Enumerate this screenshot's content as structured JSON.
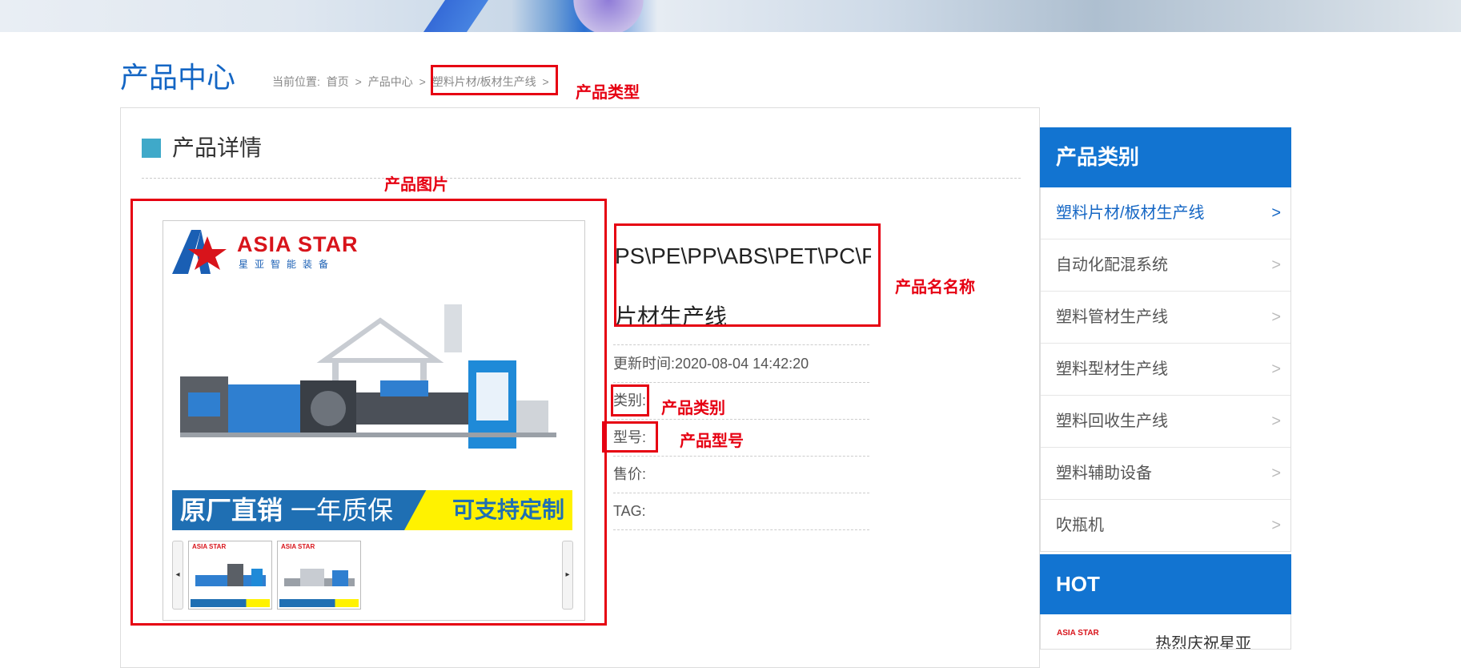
{
  "page": {
    "title": "产品中心",
    "breadcrumb": {
      "prefix": "当前位置:",
      "items": [
        "首页",
        "产品中心",
        "塑料片材/板材生产线"
      ],
      "sep": ">"
    }
  },
  "section": {
    "title": "产品详情"
  },
  "product": {
    "name_line1": "PS\\PE\\PP\\ABS\\PET\\PC\\P",
    "name_line2": "片材生产线",
    "updated": "更新时间:2020-08-04 14:42:20",
    "category_label": "类别:",
    "model_label": "型号:",
    "price_label": "售价:",
    "tag_label": "TAG:",
    "image": {
      "logo_text": "ASIA STAR",
      "logo_sub": "星亚智能装备",
      "promo_left": "原厂直销",
      "promo_left2": "一年质保",
      "promo_right": "可支持定制"
    },
    "thumbnails": [
      {
        "logo": "ASIA STAR"
      },
      {
        "logo": "ASIA STAR"
      }
    ]
  },
  "annotations": {
    "product_type": "产品类型",
    "product_image": "产品图片",
    "product_name": "产品名名称",
    "product_category": "产品类别",
    "product_model": "产品型号"
  },
  "sidebar": {
    "title": "产品类别",
    "items": [
      {
        "label": "塑料片材/板材生产线",
        "active": true
      },
      {
        "label": "自动化配混系统"
      },
      {
        "label": "塑料管材生产线"
      },
      {
        "label": "塑料型材生产线"
      },
      {
        "label": "塑料回收生产线"
      },
      {
        "label": "塑料辅助设备"
      },
      {
        "label": "吹瓶机"
      }
    ],
    "chevron": ">"
  },
  "hot": {
    "title": "HOT",
    "item_logo": "ASIA STAR",
    "item_title": "热烈庆祝星亚"
  },
  "colors": {
    "brand_blue": "#1274d1",
    "annotation_red": "#e60012",
    "section_square": "#3fa9c9"
  }
}
